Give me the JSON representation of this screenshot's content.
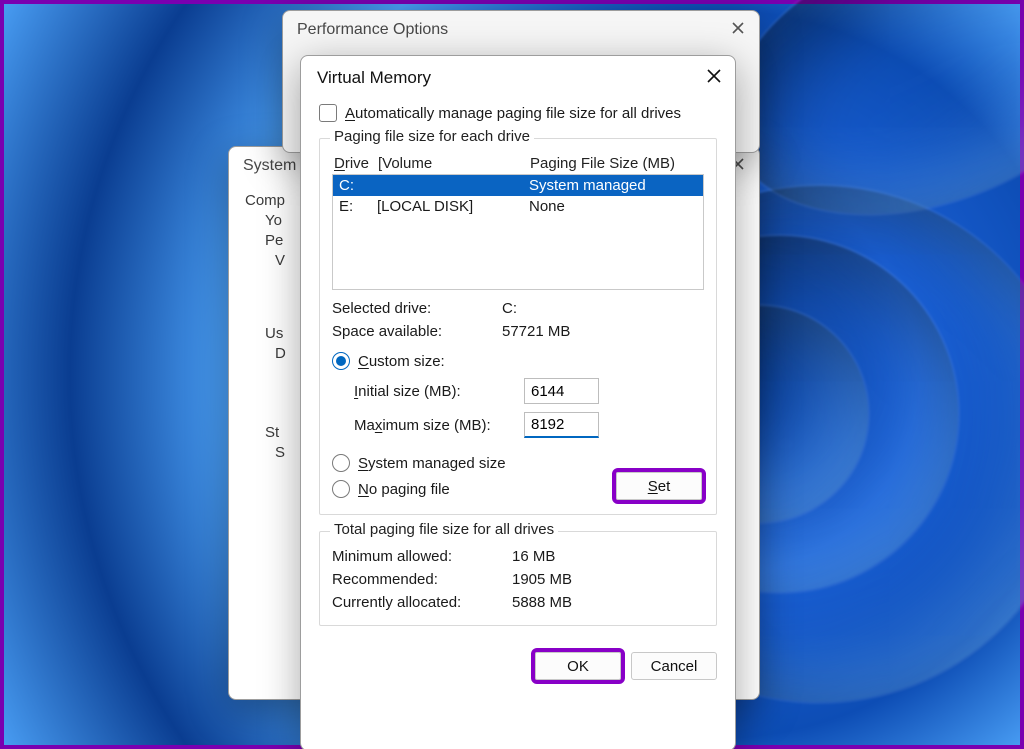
{
  "perf": {
    "title": "Performance Options"
  },
  "sys": {
    "title": "System",
    "lines": {
      "comp": "Comp",
      "yo": "Yo",
      "pe": "Pe",
      "v": "V",
      "us": "Us",
      "d": "D",
      "st": "St",
      "s": "S"
    }
  },
  "vm": {
    "title": "Virtual Memory",
    "auto_label_pre": "A",
    "auto_label_rest": "utomatically manage paging file size for all drives",
    "group_label": "Paging file size for each drive",
    "header": {
      "drive_pre": "D",
      "drive_rest": "rive",
      "volume": "[Volume",
      "size": "Paging File Size (MB)"
    },
    "drives": [
      {
        "letter": "C:",
        "volume": "",
        "size": "System managed",
        "selected": true
      },
      {
        "letter": "E:",
        "volume": "[LOCAL DISK]",
        "size": "None",
        "selected": false
      }
    ],
    "selected_drive_label": "Selected drive:",
    "selected_drive": "C:",
    "space_label": "Space available:",
    "space": "57721 MB",
    "custom_pre": "C",
    "custom_rest": "ustom size:",
    "initial_pre": "I",
    "initial_rest": "nitial size (MB):",
    "initial_value": "6144",
    "max_pre": "Ma",
    "max_u": "x",
    "max_rest": "imum size (MB):",
    "max_value": "8192",
    "sys_pre": "S",
    "sys_rest": "ystem managed size",
    "none_pre": "N",
    "none_rest": "o paging file",
    "set_pre": "S",
    "set_rest": "et",
    "total_label": "Total paging file size for all drives",
    "min_label": "Minimum allowed:",
    "min": "16 MB",
    "rec_label": "Recommended:",
    "rec": "1905 MB",
    "cur_label": "Currently allocated:",
    "cur": "5888 MB",
    "ok": "OK",
    "cancel": "Cancel"
  }
}
